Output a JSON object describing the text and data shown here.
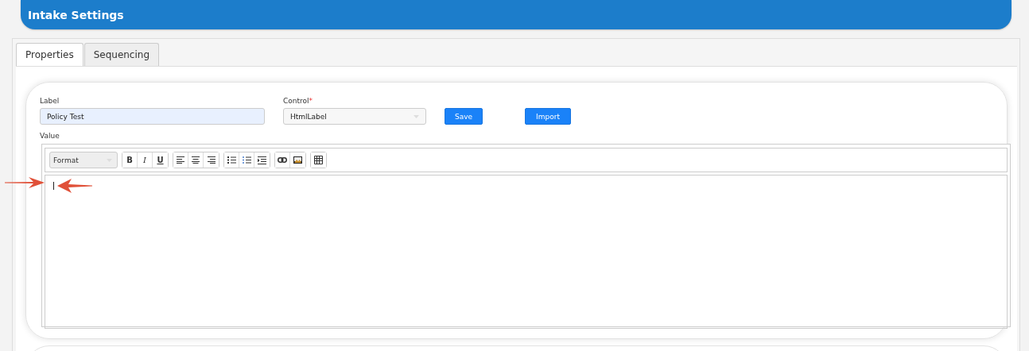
{
  "header": {
    "title": "Intake Settings"
  },
  "tabs": [
    {
      "label": "Properties",
      "selected": true
    },
    {
      "label": "Sequencing",
      "selected": false
    }
  ],
  "form": {
    "label_field": {
      "label": "Label",
      "value": "Policy Test"
    },
    "control_field": {
      "label": "Control",
      "required_mark": "*",
      "value": "HtmlLabel"
    },
    "buttons": [
      "Save",
      "Import"
    ],
    "value_label": "Value"
  },
  "editor": {
    "format": "Format",
    "text_buttons": [
      "B",
      "I",
      "U"
    ]
  }
}
